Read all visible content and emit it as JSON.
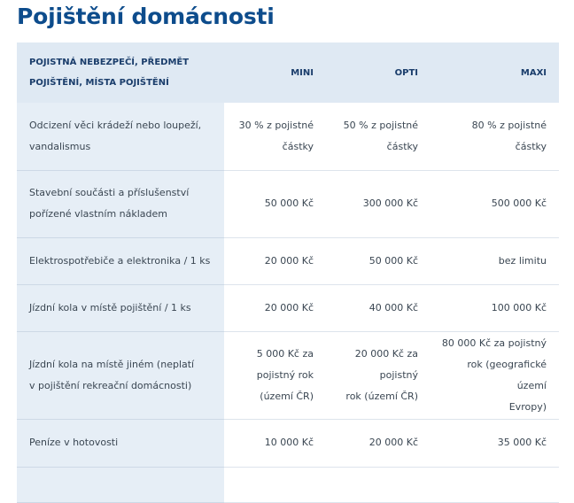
{
  "page": {
    "title": "Pojištění domácnosti"
  },
  "table": {
    "headers": {
      "col0": "Pojistná nebezpečí, předmět\npojištění, místa pojištění",
      "col1": "MINI",
      "col2": "OPTI",
      "col3": "MAXI"
    },
    "rows": [
      {
        "label": "Odcizení věci krádeží nebo loupeží,\nvandalismus",
        "mini": "30 % z pojistné\nčástky",
        "opti": "50 % z pojistné\nčástky",
        "maxi": "80 % z pojistné částky"
      },
      {
        "label": "Stavební součásti a příslušenství\npořízené vlastním nákladem",
        "mini": "50 000 Kč",
        "opti": "300 000 Kč",
        "maxi": "500 000 Kč"
      },
      {
        "label": "Elektrospotřebiče a elektronika / 1 ks",
        "mini": "20 000 Kč",
        "opti": "50 000 Kč",
        "maxi": "bez limitu"
      },
      {
        "label": "Jízdní kola v místě pojištění / 1 ks",
        "mini": "20 000 Kč",
        "opti": "40 000 Kč",
        "maxi": "100 000 Kč"
      },
      {
        "label": "Jízdní kola na místě jiném (neplatí\nv pojištění rekreační domácnosti)",
        "mini": "5 000 Kč za\npojistný rok\n(území ČR)",
        "opti": "20 000 Kč za\npojistný\nrok (území ČR)",
        "maxi": "80 000 Kč za pojistný\nrok (geografické území\nEvropy)"
      },
      {
        "label": "Peníze v hotovosti",
        "mini": "10 000 Kč",
        "opti": "20 000 Kč",
        "maxi": "35 000 Kč"
      },
      {
        "label": "",
        "mini": "",
        "opti": "",
        "maxi": ""
      }
    ]
  }
}
